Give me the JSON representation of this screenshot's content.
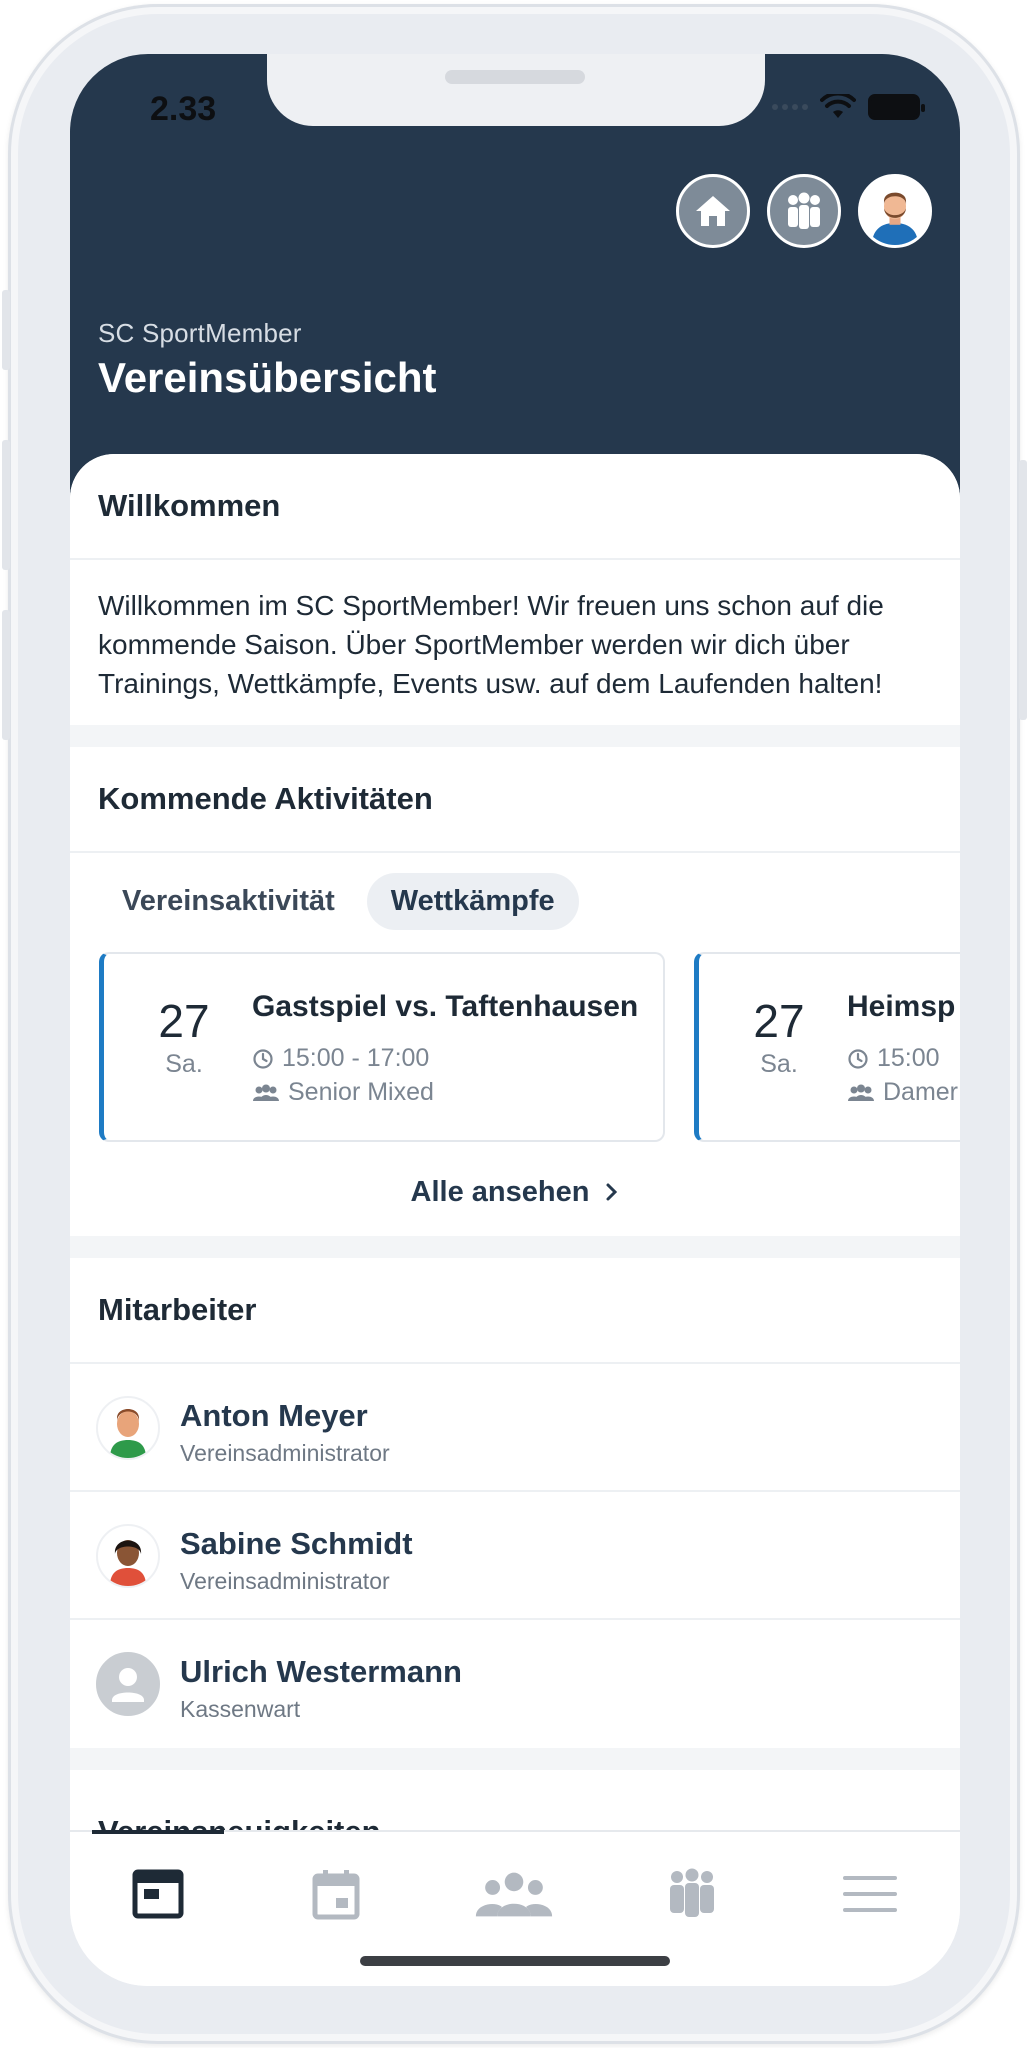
{
  "status_bar": {
    "time": "2.33"
  },
  "header": {
    "club_name": "SC SportMember",
    "page_title": "Vereinsübersicht",
    "icons": [
      "home-icon",
      "group-icon",
      "profile-avatar"
    ]
  },
  "welcome": {
    "title": "Willkommen",
    "text": "Willkommen im SC SportMember! Wir freuen uns schon auf die kommende Saison. Über SportMember werden wir dich über Trainings, Wettkämpfe, Events usw. auf dem Laufenden halten!"
  },
  "activities": {
    "title": "Kommende Aktivitäten",
    "tabs": [
      {
        "label": "Vereinsaktivität",
        "active": false
      },
      {
        "label": "Wettkämpfe",
        "active": true
      }
    ],
    "cards": [
      {
        "day": "27",
        "weekday": "Sa.",
        "title": "Gastspiel vs. Taftenhausen",
        "time": "15:00 - 17:00",
        "team": "Senior Mixed"
      },
      {
        "day": "27",
        "weekday": "Sa.",
        "title": "Heimsp",
        "time": "15:00",
        "team": "Damer"
      }
    ],
    "see_all": "Alle ansehen"
  },
  "staff": {
    "title": "Mitarbeiter",
    "members": [
      {
        "name": "Anton Meyer",
        "role": "Vereinsadministrator",
        "avatar": "avatar-man"
      },
      {
        "name": "Sabine Schmidt",
        "role": "Vereinsadministrator",
        "avatar": "avatar-woman"
      },
      {
        "name": "Ulrich Westermann",
        "role": "Kassenwart",
        "avatar": "avatar-placeholder"
      }
    ]
  },
  "news": {
    "title": "Vereinsneuigkeiten"
  },
  "bottom_nav": {
    "items": [
      "overview-icon",
      "calendar-icon",
      "members-icon",
      "teams-icon",
      "menu-icon"
    ],
    "active_index": 0
  },
  "colors": {
    "header_bg": "#25384d",
    "accent_blue": "#1e7bc4",
    "text_dark": "#1e2a36",
    "muted": "#7b8591"
  }
}
